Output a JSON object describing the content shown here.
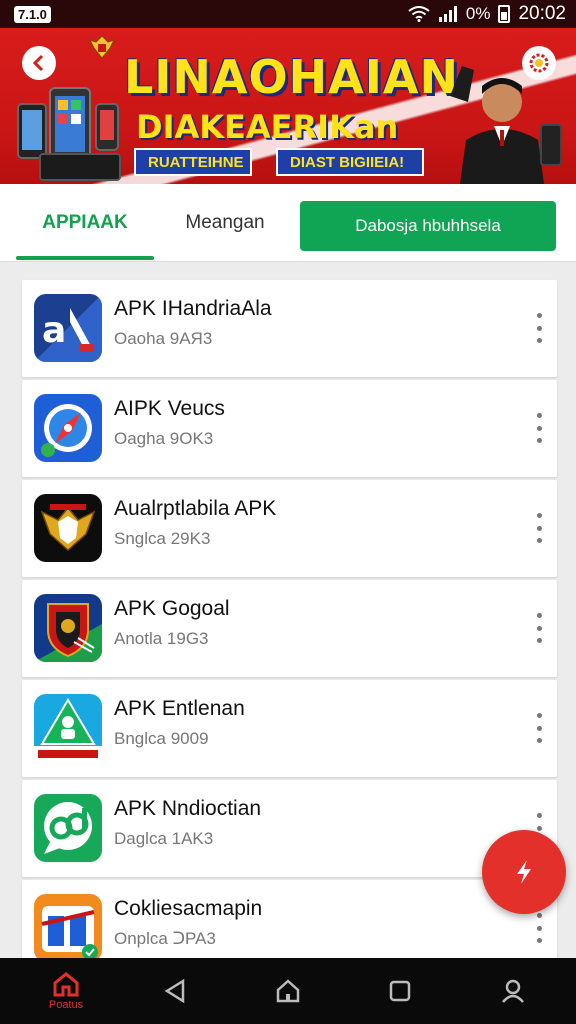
{
  "status_bar": {
    "left_badge": "7.1.0",
    "battery": "0%",
    "time": "20:02"
  },
  "banner": {
    "title_line1": "LINAOHAIAN",
    "title_line2": "DIAKEAERIKan",
    "tag1": "RUATTEIHNE",
    "tag2": "DIAST BIGIIEIA!"
  },
  "tabs": {
    "active_label": "APPIAAK",
    "second_label": "Meangan",
    "action_button": "Dabosja hbuhhsela"
  },
  "apps": [
    {
      "name": "APK IHandriaAla",
      "subtitle": "Oaoha 9AЯ3",
      "icon": "a-letter-icon"
    },
    {
      "name": "AIPK Veucs",
      "subtitle": "Oagha 9OK3",
      "icon": "compass-icon"
    },
    {
      "name": "Aualrptlabila APK",
      "subtitle": "Snglca 29K3",
      "icon": "eagle-emblem-icon"
    },
    {
      "name": "APK Gogoal",
      "subtitle": "Anotla 19G3",
      "icon": "shield-crest-icon"
    },
    {
      "name": "APK Entlenan",
      "subtitle": "Bnglca 9009",
      "icon": "triangle-person-icon"
    },
    {
      "name": "APK Nndioctian",
      "subtitle": "Daglca 1AK3",
      "icon": "chat-bubble-icon"
    },
    {
      "name": "Cokliesacmapin",
      "subtitle": "Onplca ᑐPA3",
      "icon": "map-badge-icon"
    }
  ],
  "bottom_nav": {
    "home_label": "Poatus"
  },
  "colors": {
    "accent_green": "#12a14d",
    "banner_red": "#d91c1c",
    "fab_red": "#e3302a"
  }
}
